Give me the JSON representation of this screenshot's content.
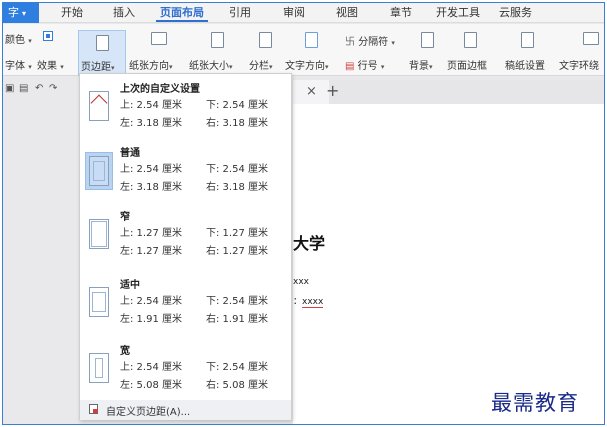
{
  "menu": {
    "app_label": "字",
    "items": [
      "开始",
      "插入",
      "页面布局",
      "引用",
      "审阅",
      "视图",
      "章节",
      "开发工具",
      "云服务"
    ],
    "active": "页面布局"
  },
  "ribbon": {
    "color_label": "颜色",
    "font_label": "字体",
    "effect_label": "效果",
    "margins_label": "页边距",
    "orientation_label": "纸张方向",
    "size_label": "纸张大小",
    "columns_label": "分栏",
    "text_dir_label": "文字方向",
    "separator_label": "分隔符",
    "line_no_label": "行号",
    "background_label": "背景",
    "border_label": "页面边框",
    "paper_setup_label": "稿纸设置",
    "wrap_label": "文字环绕"
  },
  "margins_menu": {
    "presets": [
      {
        "title": "上次的自定义设置",
        "top": "上: 2.54 厘米",
        "bottom": "下: 2.54 厘米",
        "left": "左: 3.18 厘米",
        "right": "右: 3.18 厘米",
        "icon": "last-custom-margin-icon"
      },
      {
        "title": "普通",
        "top": "上: 2.54 厘米",
        "bottom": "下: 2.54 厘米",
        "left": "左: 3.18 厘米",
        "right": "右: 3.18 厘米",
        "icon": "normal-margin-icon"
      },
      {
        "title": "窄",
        "top": "上: 1.27 厘米",
        "bottom": "下: 1.27 厘米",
        "left": "左: 1.27 厘米",
        "right": "右: 1.27 厘米",
        "icon": "narrow-margin-icon"
      },
      {
        "title": "适中",
        "top": "上: 2.54 厘米",
        "bottom": "下: 2.54 厘米",
        "left": "左: 1.91 厘米",
        "right": "右: 1.91 厘米",
        "icon": "moderate-margin-icon"
      },
      {
        "title": "宽",
        "top": "上: 2.54 厘米",
        "bottom": "下: 2.54 厘米",
        "left": "左: 5.08 厘米",
        "right": "右: 5.08 厘米",
        "icon": "wide-margin-icon"
      }
    ],
    "custom_label": "自定义页边距(A)..."
  },
  "document": {
    "heading": "大学",
    "line1": "xxx",
    "line2_prefix": "：",
    "line2_value": "xxxx"
  },
  "watermark": "最需教育",
  "colors": {
    "accent": "#2f7fe0",
    "selected": "#b9d3f2",
    "watermark": "#1a2a8a"
  }
}
